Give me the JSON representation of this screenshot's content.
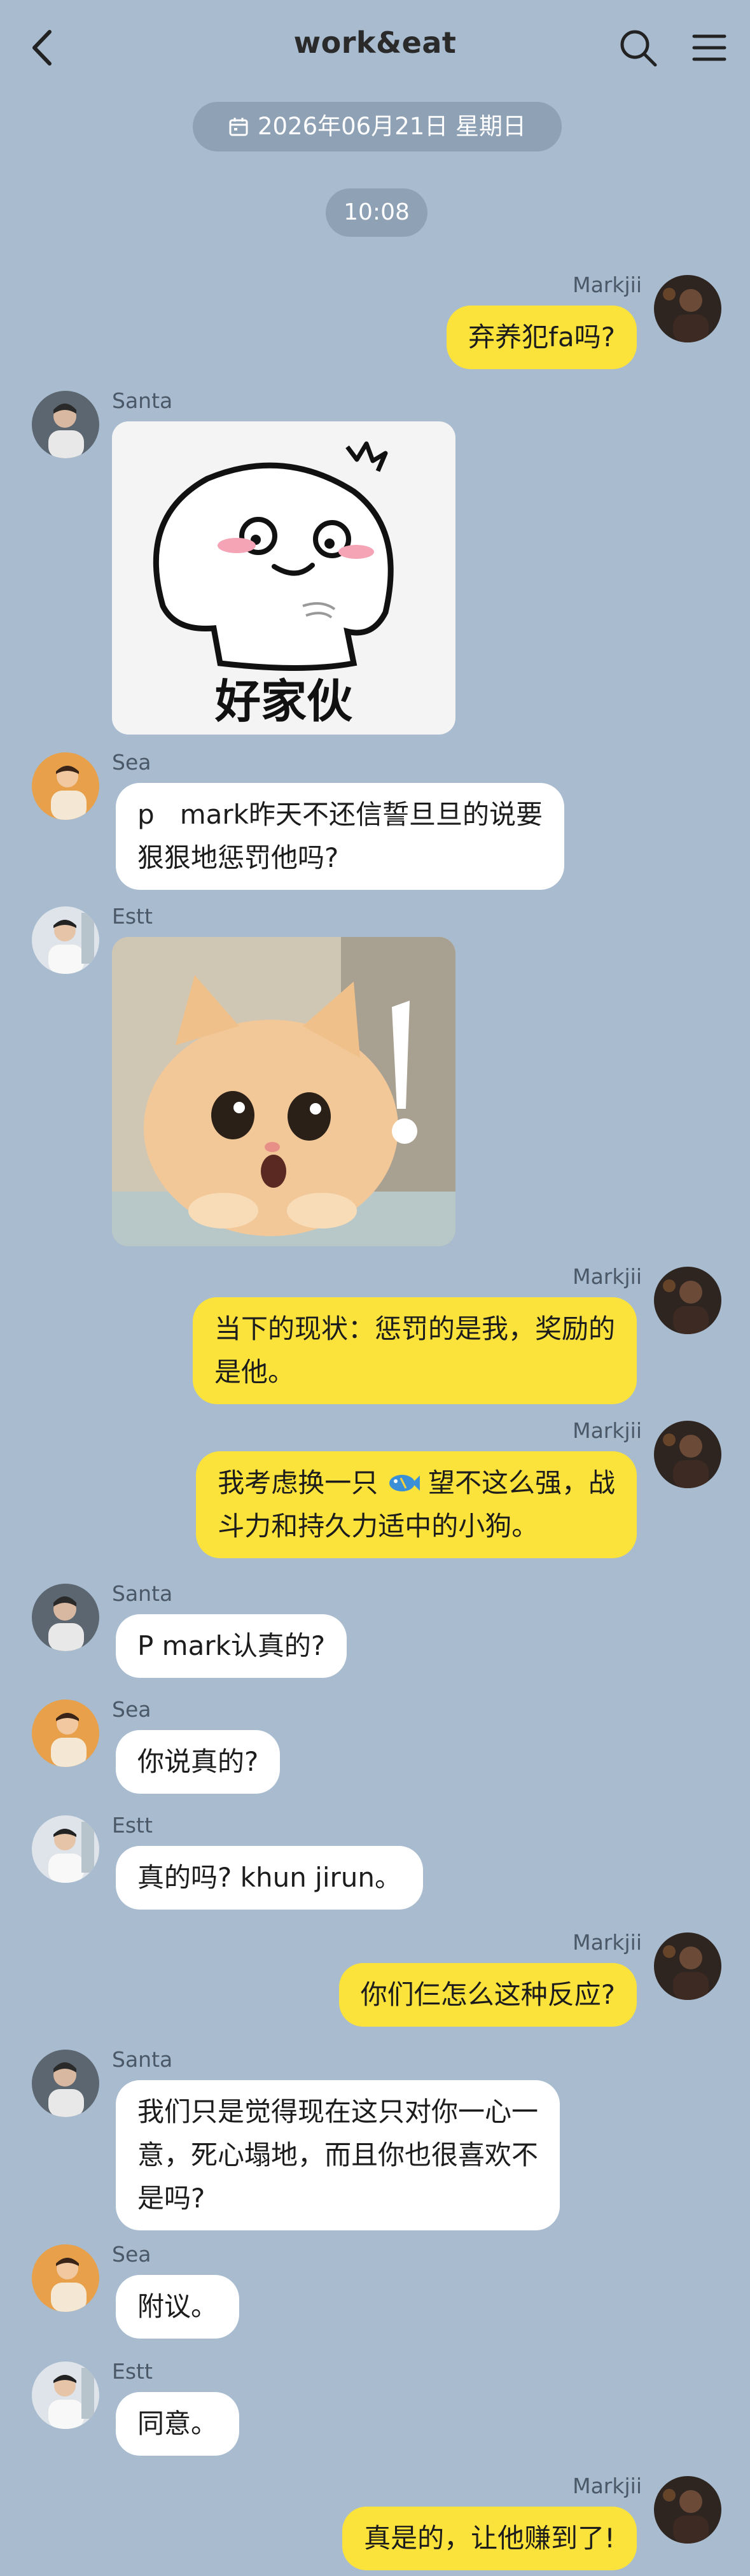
{
  "header": {
    "title": "work&eat",
    "date": "2026年06月21日  星期日",
    "time": "10:08"
  },
  "messages": [
    {
      "sender": "Markjii",
      "side": "right",
      "text": "弃养犯fa吗?"
    },
    {
      "sender": "Santa",
      "side": "left",
      "sticker": "好家伙"
    },
    {
      "sender": "Sea",
      "side": "left",
      "text": "p   mark昨天不还信誓旦旦的说要\n狠狠地惩罚他吗?"
    },
    {
      "sender": "Estt",
      "side": "left",
      "sticker": "cat-surprised"
    },
    {
      "sender": "Markjii",
      "side": "right",
      "text": "当下的现状：惩罚的是我，奖励的\n是他。"
    },
    {
      "sender": "Markjii",
      "side": "right",
      "text_before": "我考虑换一只 ",
      "text_after": " 望不这么强，战\n斗力和持久力适中的小狗。",
      "inline_icon": "fish-icon"
    },
    {
      "sender": "Santa",
      "side": "left",
      "text": "P mark认真的?"
    },
    {
      "sender": "Sea",
      "side": "left",
      "text": "你说真的?"
    },
    {
      "sender": "Estt",
      "side": "left",
      "text": "真的吗? khun jirun。"
    },
    {
      "sender": "Markjii",
      "side": "right",
      "text": "你们仨怎么这种反应?"
    },
    {
      "sender": "Santa",
      "side": "left",
      "text": "我们只是觉得现在这只对你一心一\n意，死心塌地，而且你也很喜欢不\n是吗?"
    },
    {
      "sender": "Sea",
      "side": "left",
      "text": "附议。"
    },
    {
      "sender": "Estt",
      "side": "left",
      "text": "同意。"
    },
    {
      "sender": "Markjii",
      "side": "right",
      "text": "真是的，让他赚到了!"
    }
  ],
  "icons": [
    "back-chevron-icon",
    "search-icon",
    "menu-icon",
    "calendar-icon"
  ],
  "colors": {
    "background": "#a8bbcf",
    "own_bubble": "#fbe33c",
    "other_bubble": "#ffffff",
    "pill": "#8fa2b5"
  }
}
